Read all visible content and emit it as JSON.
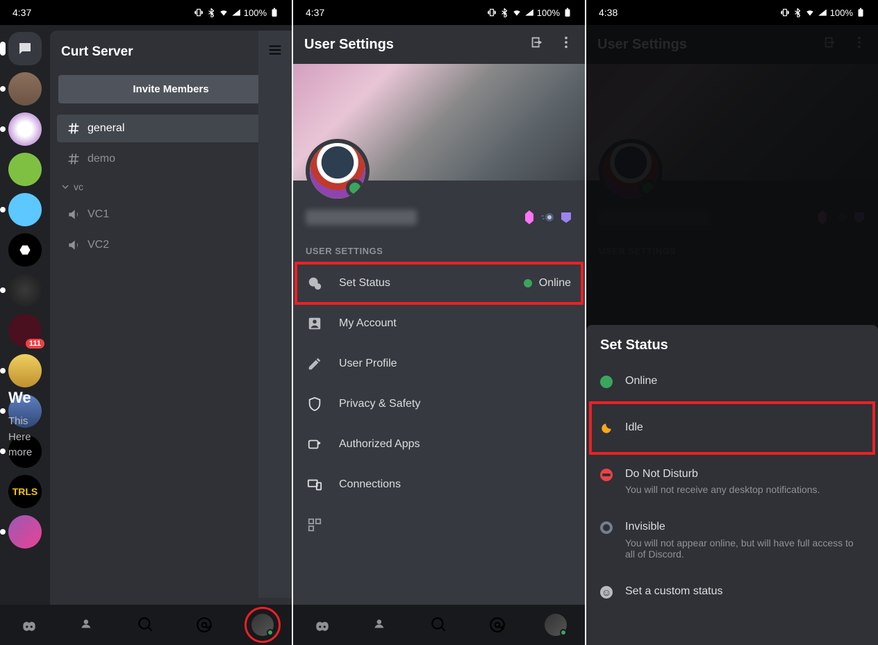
{
  "status": {
    "time1": "4:37",
    "time2": "4:37",
    "time3": "4:38",
    "battery": "100%"
  },
  "panel1": {
    "server_name": "Curt Server",
    "invite_label": "Invite Members",
    "channels": [
      {
        "name": "general"
      },
      {
        "name": "demo"
      }
    ],
    "category": "vc",
    "voice_channels": [
      {
        "name": "VC1"
      },
      {
        "name": "VC2"
      }
    ],
    "notification_count": "111",
    "server_icon_text": "TRLS",
    "peek": {
      "welcome": "We",
      "line1": "This",
      "line2": "Here",
      "line3": "more"
    }
  },
  "panel2": {
    "title": "User Settings",
    "section": "USER SETTINGS",
    "items": {
      "set_status": "Set Status",
      "status_value": "Online",
      "my_account": "My Account",
      "user_profile": "User Profile",
      "privacy": "Privacy & Safety",
      "authorized": "Authorized Apps",
      "connections": "Connections"
    }
  },
  "panel3": {
    "title": "User Settings",
    "section": "USER SETTINGS",
    "sheet_title": "Set Status",
    "options": {
      "online": "Online",
      "idle": "Idle",
      "dnd": "Do Not Disturb",
      "dnd_sub": "You will not receive any desktop notifications.",
      "invisible": "Invisible",
      "invisible_sub": "You will not appear online, but will have full access to all of Discord.",
      "custom": "Set a custom status"
    }
  }
}
